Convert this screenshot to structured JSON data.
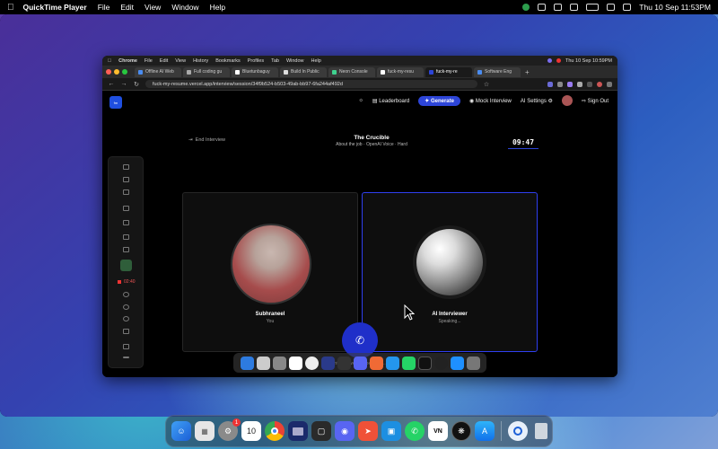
{
  "menubar": {
    "app_name": "QuickTime Player",
    "items": [
      "File",
      "Edit",
      "View",
      "Window",
      "Help"
    ],
    "clock": "Thu 10 Sep  11:53PM"
  },
  "inner_menubar": {
    "app_name": "Chrome",
    "items": [
      "File",
      "Edit",
      "View",
      "History",
      "Bookmarks",
      "Profiles",
      "Tab",
      "Window",
      "Help"
    ],
    "clock": "Thu 10 Sep  10:59PM"
  },
  "tabs": [
    {
      "label": "Offline AI Web"
    },
    {
      "label": "Full coding gu"
    },
    {
      "label": "Bluetunbaguy"
    },
    {
      "label": "Build In Public"
    },
    {
      "label": "Neon Console"
    },
    {
      "label": "fuck-my-resu"
    },
    {
      "label": "fuck-my-re",
      "active": true
    },
    {
      "label": "Software Eng"
    }
  ],
  "address": {
    "url": "fuck-my-resume.vercel.app/interview/session/34f9b524-b503-49ab-bb97-6fa244af492d"
  },
  "app": {
    "logo": "fm",
    "nav": {
      "leaderboard": "Leaderboard",
      "generate": "Generate",
      "mock_interview": "Mock Interview",
      "ai_settings": "AI Settings",
      "sign_out": "Sign Out"
    },
    "end_interview": "End Interview",
    "title": "The Crucible",
    "subtitle": "About the job · OpenAI Voice · Hard",
    "timer": "09:47",
    "recording_time": "02:40",
    "participants": {
      "user": {
        "name": "Subhraneel",
        "role": "You"
      },
      "ai": {
        "name": "AI Interviewer",
        "status": "Speaking..."
      }
    },
    "status_text": "Interviewer is speaking..."
  },
  "dock": {
    "calendar_day": "10",
    "badge": "1",
    "vn_label": "VN"
  },
  "colors": {
    "accent": "#2d45d8",
    "recording": "#e33333"
  }
}
